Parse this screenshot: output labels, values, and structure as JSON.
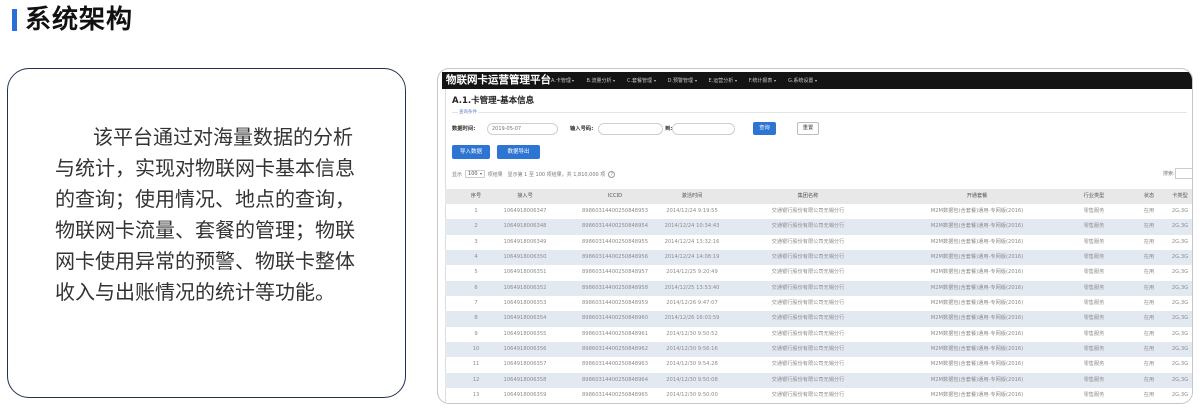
{
  "section_title": "系统架构",
  "intro": {
    "lines": [
      "该平台通过对海量数据的分析",
      "与统计，实现对物联网卡基本信息",
      "的查询；使用情况、地点的查询，",
      "物联网卡流量、套餐的管理；物联",
      "网卡使用异常的预警、物联卡整体",
      "收入与出账情况的统计等功能。"
    ]
  },
  "app": {
    "title": "物联网卡运营管理平台",
    "menu": [
      {
        "label": "A.卡管理",
        "icon": "chevron-down-icon"
      },
      {
        "label": "B.流量分析",
        "icon": "chevron-down-icon"
      },
      {
        "label": "C.套餐管理",
        "icon": "chevron-down-icon"
      },
      {
        "label": "D.预警管理",
        "icon": "chevron-down-icon"
      },
      {
        "label": "E.运营分析",
        "icon": "chevron-down-icon"
      },
      {
        "label": "F.统计报表",
        "icon": "chevron-down-icon"
      },
      {
        "label": "G.系统设置",
        "icon": "chevron-down-icon"
      }
    ],
    "page_title": "A.1.卡管理-基本信息",
    "query": {
      "legend": "查询条件",
      "date_label": "数据时间:",
      "date_value": "2019-05-07",
      "number_label": "输入号码:",
      "to_label": "到:",
      "search_button": "查询",
      "reset_button": "重置"
    },
    "actions": {
      "import_button": "导入数据",
      "export_button": "数据导出"
    },
    "paging": {
      "show_label": "显示",
      "page_size": "100",
      "page_size_suffix": "项结果",
      "summary": "显示第 1 至 100 项结果，共 1,810,000 项",
      "help_icon": "help-icon"
    },
    "search": {
      "label": "搜索:"
    },
    "table": {
      "headers": [
        "序号",
        "接入号",
        "ICCID",
        "激活时间",
        "集团名称",
        "开通套餐",
        "行业类型",
        "状态",
        "卡类型"
      ],
      "rows": [
        [
          "1",
          "1064918006347",
          "89860314400250848953",
          "2014/12/24 9:19:55",
          "交通银行股份有限公司无锡分行",
          "M2M数据包(含套餐)通用-专网版(2016)",
          "零售服务",
          "在用",
          "2G,3G"
        ],
        [
          "2",
          "1064918006348",
          "89860314400250848954",
          "2014/12/24 10:34:43",
          "交通银行股份有限公司无锡分行",
          "M2M数据包(含套餐)通用-专网版(2016)",
          "零售服务",
          "在用",
          "2G,3G"
        ],
        [
          "3",
          "1064918006349",
          "89860314400250848955",
          "2014/12/24 13:32:16",
          "交通银行股份有限公司无锡分行",
          "M2M数据包(含套餐)通用-专网版(2016)",
          "零售服务",
          "在用",
          "2G,3G"
        ],
        [
          "4",
          "1064918006350",
          "89860314400250848956",
          "2014/12/24 14:08:19",
          "交通银行股份有限公司无锡分行",
          "M2M数据包(含套餐)通用-专网版(2016)",
          "零售服务",
          "在用",
          "2G,3G"
        ],
        [
          "5",
          "1064918006351",
          "89860314400250848957",
          "2014/12/25 9:20:49",
          "交通银行股份有限公司无锡分行",
          "M2M数据包(含套餐)通用-专网版(2016)",
          "零售服务",
          "在用",
          "2G,3G"
        ],
        [
          "6",
          "1064918006352",
          "89860314400250848958",
          "2014/12/25 13:53:40",
          "交通银行股份有限公司无锡分行",
          "M2M数据包(含套餐)通用-专网版(2016)",
          "零售服务",
          "在用",
          "2G,3G"
        ],
        [
          "7",
          "1064918006353",
          "89860314400250848959",
          "2014/12/26 9:47:07",
          "交通银行股份有限公司无锡分行",
          "M2M数据包(含套餐)通用-专网版(2016)",
          "零售服务",
          "在用",
          "2G,3G"
        ],
        [
          "8",
          "1064918006354",
          "89860314400250848960",
          "2014/12/26 16:03:59",
          "交通银行股份有限公司无锡分行",
          "M2M数据包(含套餐)通用-专网版(2016)",
          "零售服务",
          "在用",
          "2G,3G"
        ],
        [
          "9",
          "1064918006355",
          "89860314400250848961",
          "2014/12/30 9:50:52",
          "交通银行股份有限公司无锡分行",
          "M2M数据包(含套餐)通用-专网版(2016)",
          "零售服务",
          "在用",
          "2G,3G"
        ],
        [
          "10",
          "1064918006356",
          "89860314400250848962",
          "2014/12/30 9:56:16",
          "交通银行股份有限公司无锡分行",
          "M2M数据包(含套餐)通用-专网版(2016)",
          "零售服务",
          "在用",
          "2G,3G"
        ],
        [
          "11",
          "1064918006357",
          "89860314400250848963",
          "2014/12/30 9:54:28",
          "交通银行股份有限公司无锡分行",
          "M2M数据包(含套餐)通用-专网版(2016)",
          "零售服务",
          "在用",
          "2G,3G"
        ],
        [
          "12",
          "1064918006358",
          "89860314400250848964",
          "2014/12/30 9:50:08",
          "交通银行股份有限公司无锡分行",
          "M2M数据包(含套餐)通用-专网版(2016)",
          "零售服务",
          "在用",
          "2G,3G"
        ],
        [
          "13",
          "1064918006359",
          "89860314400250848965",
          "2014/12/30 9:50:00",
          "交通银行股份有限公司无锡分行",
          "M2M数据包(含套餐)通用-专网版(2016)",
          "零售服务",
          "在用",
          "2G,3G"
        ]
      ]
    }
  },
  "colors": {
    "title_accent": "#2b6fd4",
    "intro_border": "#24314f",
    "navbar": "#141414",
    "primary_button": "#2e74d2",
    "row_stripe": "#e3e9f1"
  }
}
